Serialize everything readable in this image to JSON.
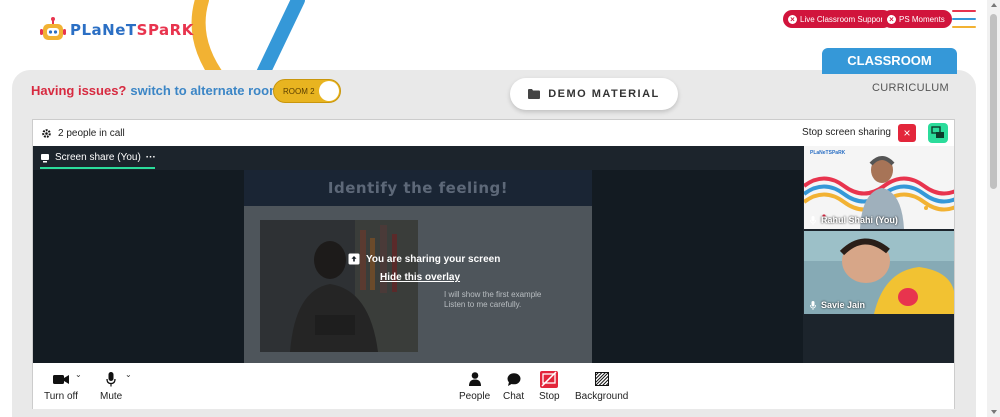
{
  "brand": {
    "part1": "PLaNeT",
    "part2": "SPaRK"
  },
  "header": {
    "live_support_label": "Live Classroom Support",
    "ps_moments_label": "PS Moments",
    "hamburger_colors": [
      "#e8344e",
      "#3598d8",
      "#f2b233"
    ]
  },
  "tabs": {
    "classroom": "CLASSROOM",
    "curriculum": "CURRICULUM"
  },
  "issues": {
    "question": "Having issues?",
    "action": "switch to alternate room",
    "room_toggle": "ROOM 2"
  },
  "demo_material": {
    "label": "DEMO MATERIAL",
    "icon": "folder-icon"
  },
  "call": {
    "participants_text": "2 people in call",
    "stop_share_text": "Stop screen sharing",
    "share_tab_label": "Screen share (You)",
    "share_tab_more": "···",
    "slide_title": "Identify the feeling!",
    "slide_text_line1": "I will show the first example",
    "slide_text_line2": "Listen to me carefully.",
    "overlay_message": "You are sharing your screen",
    "overlay_link": "Hide this overlay",
    "tiles": [
      {
        "name": "Rahul Shahi (You)",
        "tile_brand": "PLaNeTSPaRK"
      },
      {
        "name": "Savie Jain"
      }
    ]
  },
  "toolbar": {
    "camera_label": "Turn off",
    "mic_label": "Mute",
    "people_label": "People",
    "chat_label": "Chat",
    "stop_label": "Stop",
    "background_label": "Background"
  },
  "colors": {
    "accent_red": "#d1143c",
    "accent_blue": "#3598d8",
    "accent_green": "#2bdc9b",
    "room_yellow": "#e8b420"
  }
}
